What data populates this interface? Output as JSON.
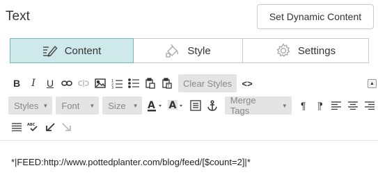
{
  "header": {
    "title": "Text",
    "dynamic_button": "Set Dynamic Content"
  },
  "tabs": [
    {
      "label": "Content",
      "icon": "pencil-lines-icon",
      "active": true
    },
    {
      "label": "Style",
      "icon": "paint-bucket-icon",
      "active": false
    },
    {
      "label": "Settings",
      "icon": "gear-icon",
      "active": false
    }
  ],
  "toolbar": {
    "bold": "B",
    "italic": "I",
    "underline": "U",
    "clear_styles": "Clear Styles",
    "styles": "Styles",
    "font": "Font",
    "size": "Size",
    "merge_tags": "Merge Tags",
    "source_glyph": "<>"
  },
  "editor": {
    "content": "*|FEED:http://www.pottedplanter.com/blog/feed/[$count=2]|*"
  },
  "colors": {
    "accent_bg": "#cfe8ea",
    "accent_border": "#6fb6bd",
    "toolbar_btn_bg": "#e4e4e4"
  }
}
